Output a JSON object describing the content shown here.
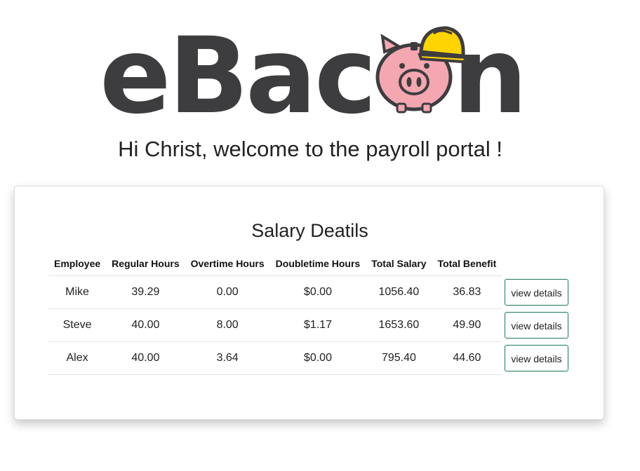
{
  "logo": {
    "text_e": "e",
    "text_b": "B",
    "text_a": "a",
    "text_c": "c",
    "text_n": "n",
    "text_color": "#3d3d3f",
    "pig_color": "#f4a7b1",
    "helmet_color": "#ffd400"
  },
  "welcome": "Hi Christ, welcome to the payroll portal !",
  "salary": {
    "title": "Salary Deatils",
    "headers": [
      "Employee",
      "Regular Hours",
      "Overtime Hours",
      "Doubletime Hours",
      "Total Salary",
      "Total Benefit"
    ],
    "rows": [
      {
        "employee": "Mike",
        "regular": "39.29",
        "overtime": "0.00",
        "doubletime": "$0.00",
        "salary": "1056.40",
        "benefit": "36.83",
        "action": "view details"
      },
      {
        "employee": "Steve",
        "regular": "40.00",
        "overtime": "8.00",
        "doubletime": "$1.17",
        "salary": "1653.60",
        "benefit": "49.90",
        "action": "view details"
      },
      {
        "employee": "Alex",
        "regular": "40.00",
        "overtime": "3.64",
        "doubletime": "$0.00",
        "salary": "795.40",
        "benefit": "44.60",
        "action": "view details"
      }
    ]
  },
  "colors": {
    "button_border": "#1c7a55"
  }
}
